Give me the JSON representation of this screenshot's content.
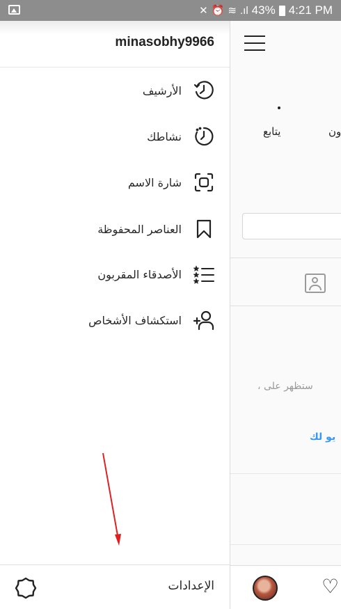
{
  "status_bar": {
    "battery": "43%",
    "time": "4:21 PM"
  },
  "drawer": {
    "username": "minasobhy9966",
    "items": [
      {
        "label": "الأرشيف",
        "icon": "archive-history-icon"
      },
      {
        "label": "نشاطك",
        "icon": "activity-timer-icon"
      },
      {
        "label": "شارة الاسم",
        "icon": "nametag-icon"
      },
      {
        "label": "العناصر المحفوظة",
        "icon": "bookmark-icon"
      },
      {
        "label": "الأصدقاء المقربون",
        "icon": "close-friends-list-icon"
      },
      {
        "label": "استكشاف الأشخاص",
        "icon": "add-person-icon"
      }
    ],
    "settings_label": "الإعدادات",
    "settings_icon": "gear-icon"
  },
  "background_profile": {
    "follow_label": "يتابع",
    "followers_partial": "ون",
    "empty_text_partial": "، ستظهر على",
    "link_partial": "يو لك"
  },
  "colors": {
    "status_bar": "#8d8d8d",
    "annotation_arrow": "#e02020",
    "link": "#3897f0"
  }
}
